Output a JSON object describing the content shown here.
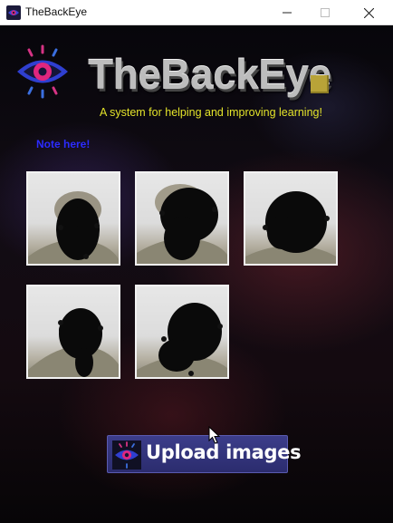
{
  "window": {
    "title": "TheBackEye",
    "controls": [
      "minimize",
      "maximize",
      "close"
    ]
  },
  "header": {
    "brand": "TheBackEye",
    "tagline": "A system for helping and improving learning!"
  },
  "note": "Note here!",
  "thumbnails": [
    {
      "id": 1,
      "content": "obscured face photo"
    },
    {
      "id": 2,
      "content": "obscured face photo"
    },
    {
      "id": 3,
      "content": "obscured face photo"
    },
    {
      "id": 4,
      "content": "obscured face photo"
    },
    {
      "id": 5,
      "content": "obscured face photo"
    }
  ],
  "upload_button": {
    "label": "Upload images",
    "icon": "eye-logo-icon"
  },
  "colors": {
    "tagline": "#e3e32a",
    "note": "#2b2bff",
    "button": "#2b2c6e",
    "brand_square": "#b8a338"
  }
}
